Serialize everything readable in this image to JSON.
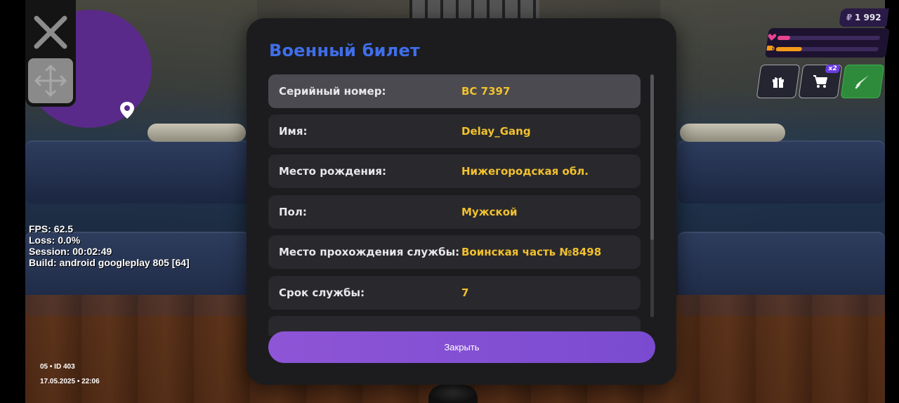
{
  "hud": {
    "money_currency": "₽",
    "money_value": "1 992",
    "health_level": 0.12,
    "hunger_level": 0.25,
    "health_color": "#e8448f",
    "hunger_color": "#f39a1a",
    "gift_icon": "gift-icon",
    "cart_icon": "cart-icon",
    "cart_badge": "x2",
    "weapon_icon": "knife-icon"
  },
  "debug": {
    "fps": "FPS: 62.5",
    "loss": "Loss: 0.0%",
    "session": "Session: 00:02:49",
    "build": "Build: android googleplay 805 [64]"
  },
  "footer": {
    "server_id": "05 • ID 403",
    "datetime": "17.05.2025 • 22:06"
  },
  "modal": {
    "title": "Военный билет",
    "rows": [
      {
        "label": "Серийный номер:",
        "value": "BC 7397"
      },
      {
        "label": "Имя:",
        "value": "Delay_Gang"
      },
      {
        "label": "Место рождения:",
        "value": "Нижегородская обл."
      },
      {
        "label": "Пол:",
        "value": "Мужской"
      },
      {
        "label": "Место прохождения службы:",
        "value": "Воинская часть №8498"
      },
      {
        "label": "Срок службы:",
        "value": "7"
      }
    ],
    "close_label": "Закрыть"
  },
  "colors": {
    "title": "#3f6ee8",
    "value": "#f2c12e",
    "button": "#8e55d6",
    "map": "#5a2a8a"
  }
}
